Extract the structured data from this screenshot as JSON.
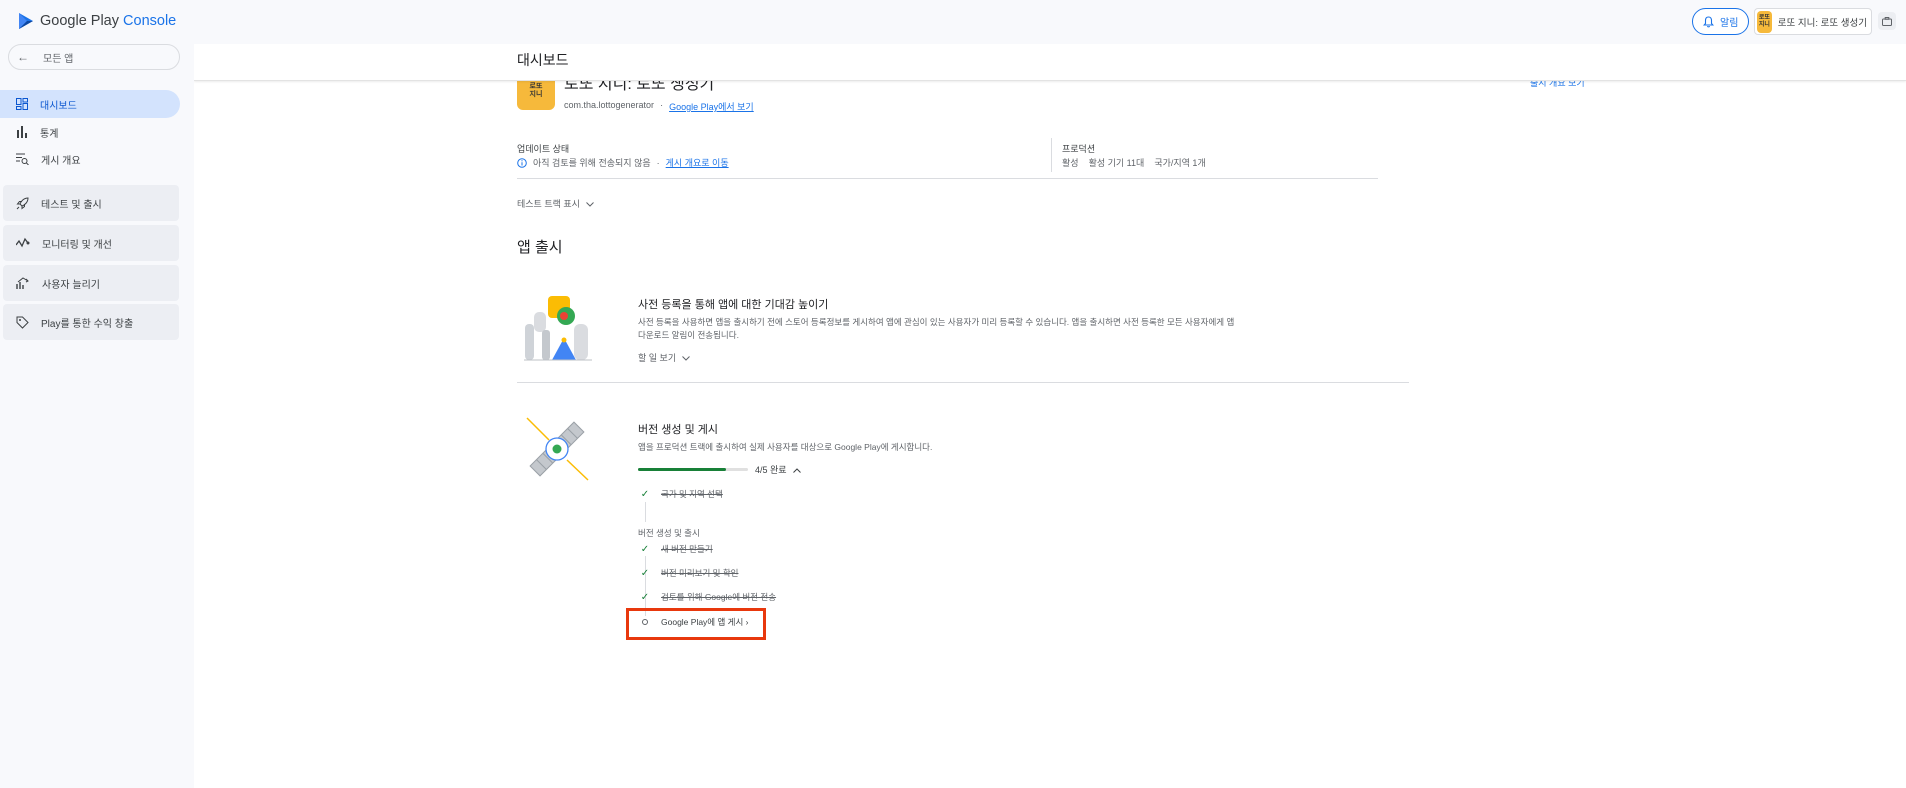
{
  "app": {
    "logo_text_a": "Google Play ",
    "logo_text_b": "Console"
  },
  "topbar": {
    "notifications_label": "알림",
    "app_name": "로또 지니: 로또 생성기",
    "app_icon_text": "로또\n지니"
  },
  "sidebar": {
    "back_label": "모든 앱",
    "items": [
      {
        "label": "대시보드",
        "icon": "dashboard-icon",
        "active": true
      },
      {
        "label": "통계",
        "icon": "bar-chart-icon",
        "active": false
      },
      {
        "label": "게시 개요",
        "icon": "publishing-overview-icon",
        "active": false
      }
    ],
    "groups": [
      {
        "label": "테스트 및 출시",
        "icon": "rocket-icon"
      },
      {
        "label": "모니터링 및 개선",
        "icon": "monitoring-icon"
      },
      {
        "label": "사용자 늘리기",
        "icon": "grow-users-icon"
      },
      {
        "label": "Play를 통한 수익 창출",
        "icon": "tag-icon"
      }
    ]
  },
  "main": {
    "page_title": "대시보드",
    "app_title": "로또 지니: 로또 생성기",
    "release_overview_link": "출시 개요 보기",
    "package_name": "com.tha.lottogenerator",
    "package_sep": "·",
    "view_on_play": "Google Play에서 보기",
    "update_status_label": "업데이트 상태",
    "update_status_text": "아직 검토를 위해 전송되지 않음",
    "update_status_sep": "·",
    "go_to_overview": "게시 개요로 이동",
    "production_label": "프로덕션",
    "production_status": "활성",
    "production_devices": "활성 기기 11대",
    "production_countries": "국가/지역 1개",
    "test_track_toggle": "테스트 트랙 표시",
    "section_title": "앱 출시",
    "card1": {
      "title": "사전 등록을 통해 앱에 대한 기대감 높이기",
      "description": "사전 등록을 사용하면 앱을 출시하기 전에 스토어 등록정보를 게시하여 앱에 관심이 있는 사용자가 미리 등록할 수 있습니다. 앱을 출시하면 사전 등록한 모든 사용자에게 앱 다운로드 알림이 전송됩니다.",
      "todo_toggle": "할 일 보기"
    },
    "card2": {
      "title": "버전 생성 및 게시",
      "description": "앱을 프로덕션 트랙에 출시하여 실제 사용자를 대상으로 Google Play에 게시합니다.",
      "progress_text": "4/5 완료",
      "progress_fraction": 0.8,
      "step_countries": "국가 및 지역 선택",
      "group_label": "버전 생성 및 출시",
      "steps": [
        {
          "label": "새 버전 만들기",
          "done": true
        },
        {
          "label": "버전 미리보기 및 확인",
          "done": true
        },
        {
          "label": "검토를 위해 Google에 버전 전송",
          "done": true
        }
      ],
      "publish_step": "Google Play에 앱 게시"
    }
  },
  "colors": {
    "accent": "#1a73e8",
    "active_nav_bg": "#d3e3fd",
    "progress_green": "#188038",
    "highlight": "#e8380d"
  }
}
